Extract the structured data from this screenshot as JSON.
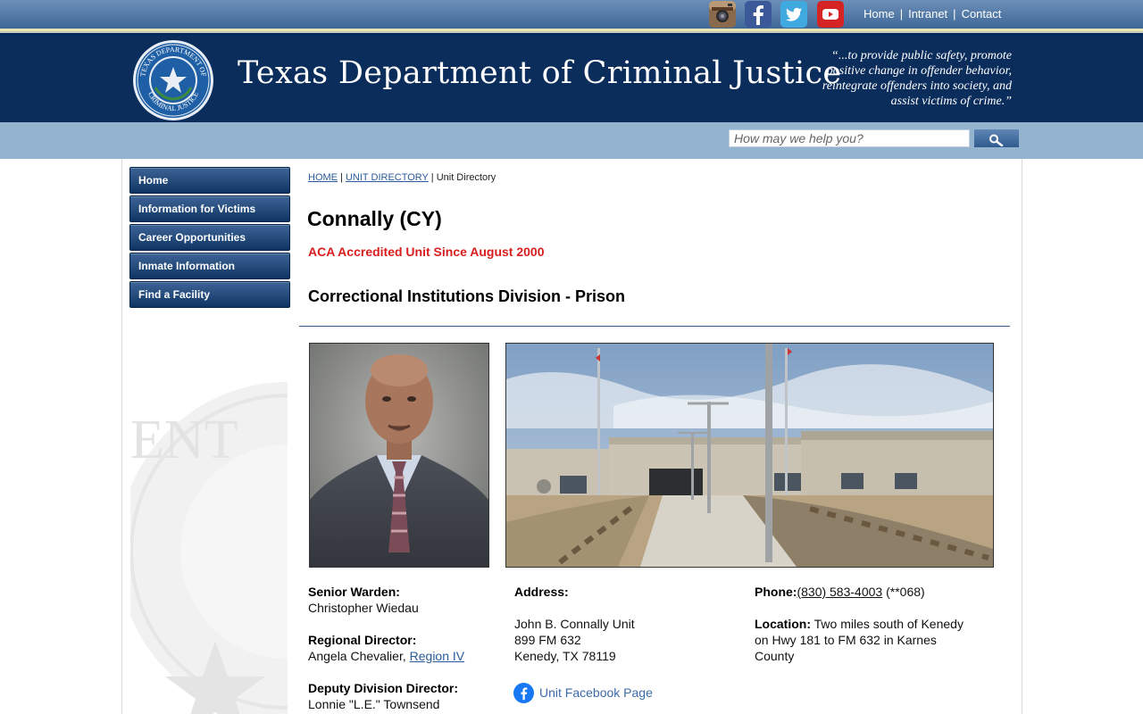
{
  "topbar": {
    "social": [
      "instagram-icon",
      "facebook-icon",
      "twitter-icon",
      "youtube-icon"
    ],
    "links": [
      "Home",
      "Intranet",
      "Contact"
    ],
    "separator": "|"
  },
  "header": {
    "title": "Texas Department of Criminal Justice",
    "mission": "“...to provide public safety, promote positive change in offender behavior, reintegrate offenders into society, and assist victims of crime.”",
    "seal_text_top": "TEXAS DEPARTMENT OF",
    "seal_text_bottom": "CRIMINAL JUSTICE"
  },
  "search": {
    "placeholder": "How may we help you?",
    "button_icon": "search-icon"
  },
  "sidebar": {
    "items": [
      "Home",
      "Information for Victims",
      "Career Opportunities",
      "Inmate Information",
      "Find a Facility"
    ]
  },
  "breadcrumb": {
    "home": "HOME",
    "sep": "|",
    "unit_directory": "UNIT DIRECTORY",
    "current": "Unit Directory"
  },
  "unit": {
    "name": "Connally (CY)",
    "accreditation": "ACA Accredited Unit Since August 2000",
    "division": "Correctional Institutions Division - Prison"
  },
  "staff": {
    "senior_warden_label": "Senior Warden:",
    "senior_warden": "Christopher Wiedau",
    "regional_director_label": "Regional Director:",
    "regional_director": "Angela Chevalier, ",
    "region_link": "Region IV",
    "deputy_label": "Deputy Division Director:",
    "deputy": "Lonnie \"L.E.\" Townsend"
  },
  "address": {
    "label": "Address:",
    "line1": "John B. Connally Unit",
    "line2": "899 FM 632",
    "line3": "Kenedy, TX 78119",
    "facebook_label": "Unit Facebook Page"
  },
  "contact": {
    "phone_label": "Phone:",
    "phone": "(830) 583-4003",
    "phone_ext": " (**068)",
    "location_label": "Location:",
    "location": " Two miles south of Kenedy on Hwy 181 to FM 632 in Karnes County"
  },
  "colors": {
    "header_navy": "#0b2d5c",
    "accent_red": "#d81e1e",
    "link_blue": "#2a5a99"
  }
}
